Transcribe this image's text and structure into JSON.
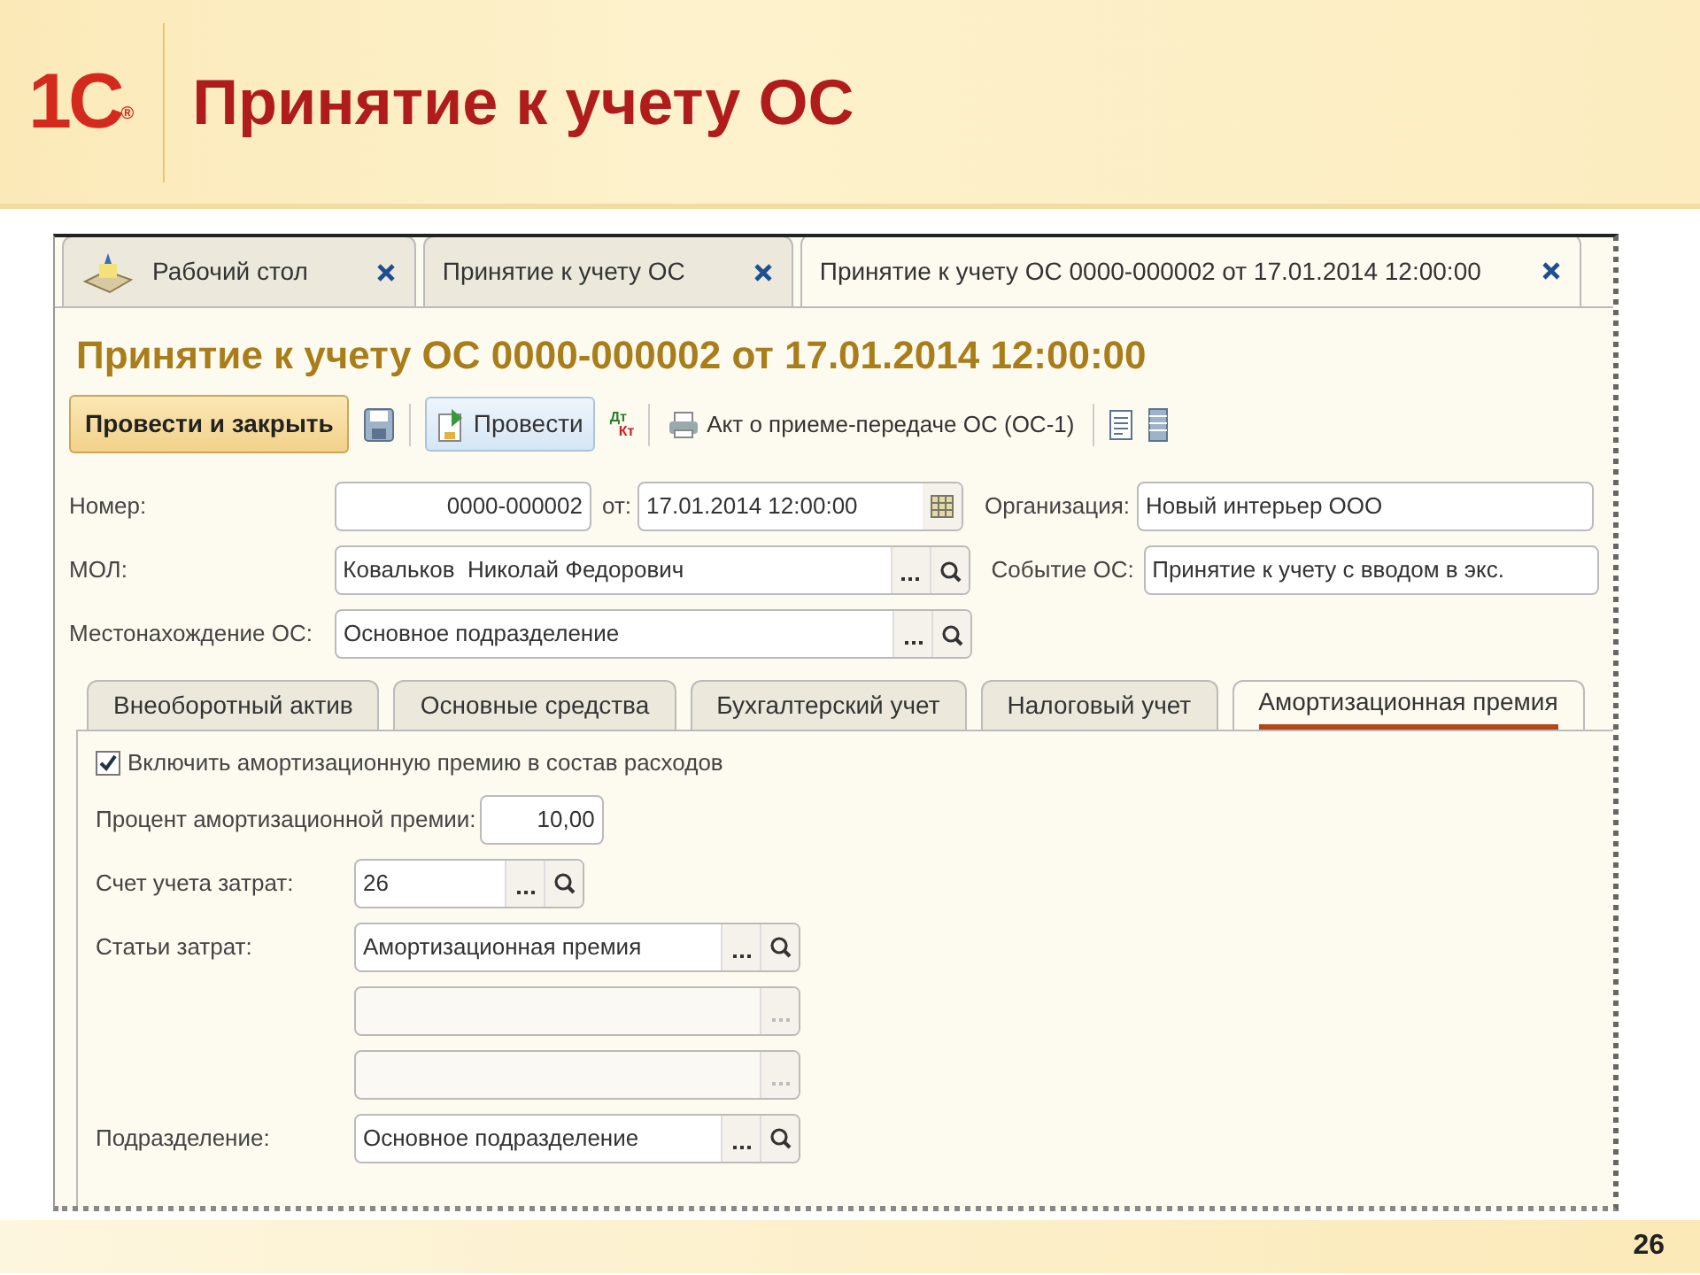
{
  "slide": {
    "logo": "1С",
    "logo_mark": "®",
    "title": "Принятие к учету ОС",
    "page_number": "26"
  },
  "window": {
    "tabs": [
      {
        "label": "Рабочий стол",
        "kind": "desktop",
        "selected": false
      },
      {
        "label": "Принятие к учету ОС",
        "kind": "list",
        "selected": false
      },
      {
        "label": "Принятие к учету ОС 0000-000002 от 17.01.2014 12:00:00",
        "kind": "document",
        "selected": true
      }
    ],
    "heading": "Принятие к учету ОС 0000-000002 от 17.01.2014 12:00:00",
    "toolbar": [
      {
        "kind": "primary",
        "label": "Провести и закрыть"
      },
      {
        "kind": "save"
      },
      {
        "kind": "post",
        "label": "Провести"
      },
      {
        "kind": "dtkt",
        "label_top": "Дт",
        "label_bottom": "Кт"
      },
      {
        "kind": "print",
        "label": "Акт о приеме-передаче ОС (ОС-1)"
      },
      {
        "kind": "report"
      },
      {
        "kind": "list"
      }
    ],
    "header_rows": [
      [
        {
          "label": "Номер:",
          "value": "0000-000002",
          "kind": "number"
        },
        {
          "label": "от:",
          "value": "17.01.2014 12:00:00",
          "kind": "date"
        },
        {
          "label": "Организация:",
          "value": "Новый интерьер ООО",
          "kind": "text"
        }
      ],
      [
        {
          "label": "МОЛ:",
          "value": "Ковальков  Николай Федорович",
          "kind": "ref"
        },
        {
          "label": "Событие ОС:",
          "value": "Принятие к учету с вводом в экс.",
          "kind": "text"
        }
      ],
      [
        {
          "label": "Местонахождение ОС:",
          "value": "Основное подразделение",
          "kind": "ref"
        }
      ]
    ],
    "subtabs": [
      {
        "label": "Внеоборотный актив",
        "selected": false
      },
      {
        "label": "Основные средства",
        "selected": false
      },
      {
        "label": "Бухгалтерский учет",
        "selected": false
      },
      {
        "label": "Налоговый учет",
        "selected": false
      },
      {
        "label": "Амортизационная премия",
        "selected": true
      }
    ],
    "checkbox": {
      "label": "Включить амортизационную премию в состав расходов",
      "checked": true
    },
    "fields": [
      {
        "label": "Процент амортизационной премии:",
        "value": "10,00",
        "kind": "number"
      },
      {
        "label": "Счет учета затрат:",
        "value": "26",
        "kind": "short_ref"
      },
      {
        "label": "Статьи затрат:",
        "value": "Амортизационная премия",
        "kind": "ref"
      },
      {
        "kind": "empty_ref"
      },
      {
        "kind": "empty_ref"
      },
      {
        "label": "Подразделение:",
        "value": "Основное подразделение",
        "kind": "ref"
      }
    ]
  }
}
